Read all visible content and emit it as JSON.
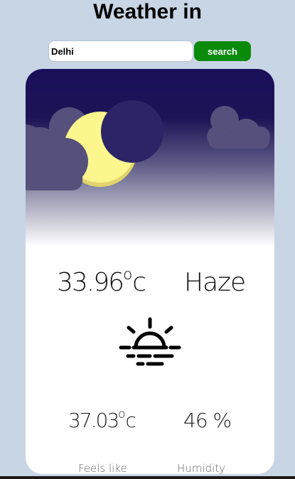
{
  "header": {
    "title": "Weather in"
  },
  "search": {
    "value": "Delhi",
    "button_label": "search"
  },
  "weather": {
    "temperature": "33.96",
    "temperature_unit_degree": "o",
    "temperature_unit": "c",
    "condition": "Haze",
    "condition_icon": "haze-icon",
    "feels_like": "37.03",
    "feels_like_unit_degree": "o",
    "feels_like_unit": "c",
    "humidity": "46 %",
    "feels_like_label": "Feels like",
    "humidity_label": "Humidity"
  },
  "colors": {
    "page_background": "#c8d5e4",
    "button_green": "#0c8a0c",
    "sky_top": "#1a0f5a",
    "moon": "#fbf68e",
    "cloud": "#55517c"
  }
}
